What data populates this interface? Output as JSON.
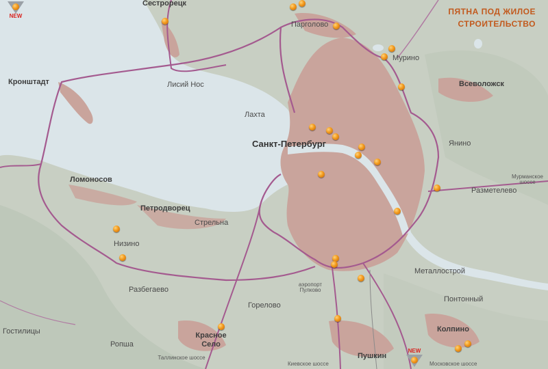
{
  "title": {
    "line1": "ПЯТНА ПОД ЖИЛОЕ",
    "line2": "СТРОИТЕЛЬСТВО"
  },
  "badges": {
    "new_label": "NEW"
  },
  "places": {
    "sestroretsk": "Сестрорецк",
    "pargolovo": "Парголово",
    "murino": "Мурино",
    "kronshtadt": "Кронштадт",
    "lisiy_nos": "Лисий Нос",
    "vsevolozhsk": "Всеволожск",
    "lakhta": "Лахта",
    "spb": "Санкт-Петербург",
    "yanino": "Янино",
    "lomonosov": "Ломоносов",
    "razmetelevo": "Разметелево",
    "murmanskoe": "Мурманское шоссе",
    "petrodvorets": "Петродворец",
    "strelna": "Стрельна",
    "nizino": "Низино",
    "metallostroy": "Металлострой",
    "razbegaevo": "Разбегаево",
    "airport": "аэропорт Пулково",
    "gorelovo": "Горелово",
    "pontonny": "Понтонный",
    "gostilitsy": "Гостилицы",
    "krasnoe_selo": "Красное Село",
    "ropsha": "Ропша",
    "kolpino": "Колпино",
    "tallinskoe": "Таллинское шоссе",
    "pushkin": "Пушкин",
    "kievskoe": "Киевское шоссе",
    "moskovskoe": "Московское шоссе"
  },
  "colors": {
    "marker": "#f29a1c",
    "ring_road": "#a45a8f",
    "water": "#dbe6ea",
    "land": "#c9d0c4",
    "city": "#c9a49c",
    "title": "#c25a1e"
  }
}
